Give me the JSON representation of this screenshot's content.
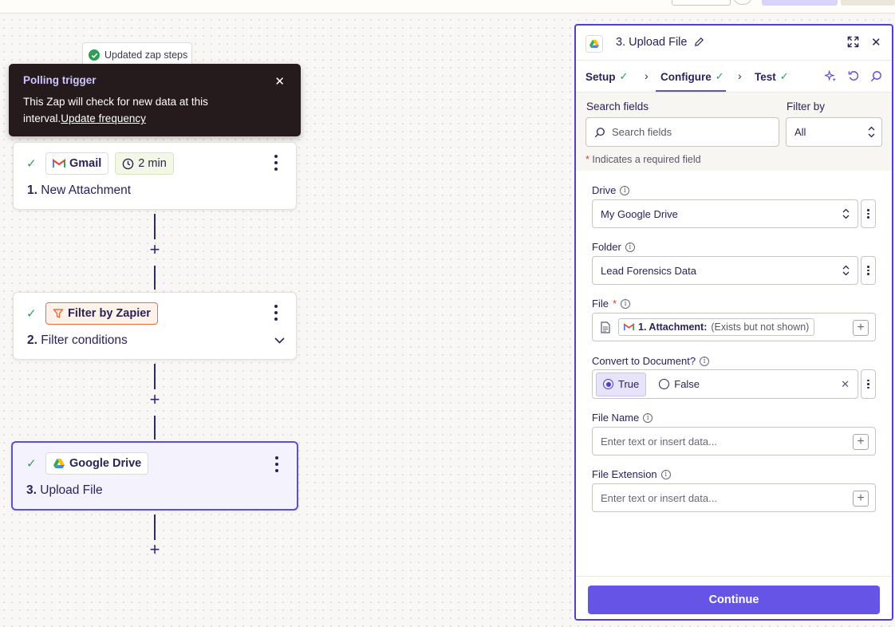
{
  "toast": {
    "text": "Updated zap steps"
  },
  "tooltip": {
    "title": "Polling trigger",
    "body": "This Zap will check for new data at this interval.",
    "link": "Update frequency"
  },
  "steps": [
    {
      "app": "Gmail",
      "badge": "2 min",
      "number": "1.",
      "title": "New Attachment"
    },
    {
      "app": "Filter by Zapier",
      "number": "2.",
      "title": "Filter conditions"
    },
    {
      "app": "Google Drive",
      "number": "3.",
      "title": "Upload File"
    }
  ],
  "panel": {
    "title": "3. Upload File",
    "tabs": [
      {
        "label": "Setup"
      },
      {
        "label": "Configure"
      },
      {
        "label": "Test"
      }
    ],
    "search": {
      "label": "Search fields",
      "placeholder": "Search fields",
      "filter_label": "Filter by",
      "filter_value": "All"
    },
    "required_note": "Indicates a required field",
    "fields": {
      "drive": {
        "label": "Drive",
        "value": "My Google Drive"
      },
      "folder": {
        "label": "Folder",
        "value": "Lead Forensics Data"
      },
      "file": {
        "label": "File",
        "chip_bold": "1. Attachment:",
        "chip_rest": "(Exists but not shown)"
      },
      "convert": {
        "label": "Convert to Document?",
        "opt_true": "True",
        "opt_false": "False"
      },
      "file_name": {
        "label": "File Name",
        "placeholder": "Enter text or insert data..."
      },
      "file_ext": {
        "label": "File Extension",
        "placeholder": "Enter text or insert data..."
      }
    },
    "continue_label": "Continue"
  },
  "colors": {
    "accent": "#6554e6",
    "selected_border": "#5d4fd2",
    "success": "#2e9e57",
    "tooltip_bg": "#251a1c",
    "filter_orange": "#ea6f3a"
  }
}
